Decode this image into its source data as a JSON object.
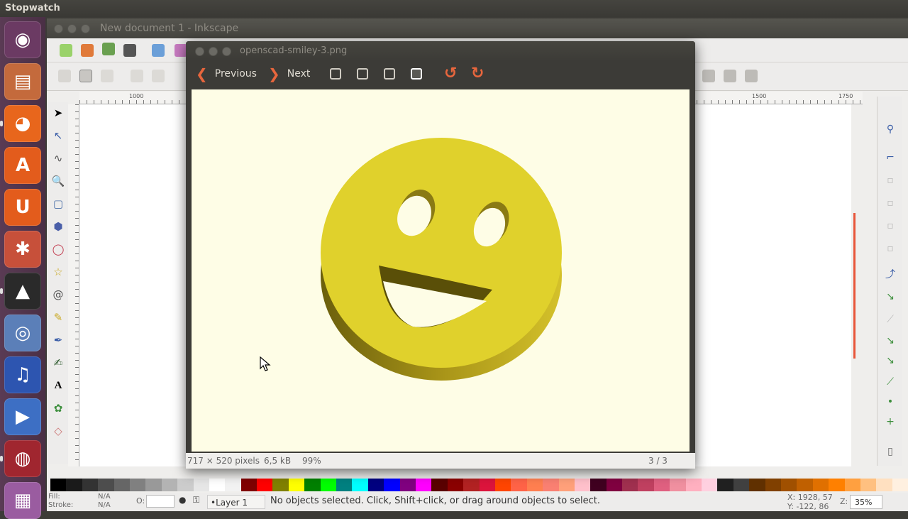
{
  "top_panel": {
    "title": "Stopwatch"
  },
  "launcher": {
    "items": [
      {
        "name": "ubuntu-dash-icon",
        "glyph": "◉",
        "color": "#6b3a63"
      },
      {
        "name": "files-icon",
        "glyph": "▤",
        "color": "#c46a3c"
      },
      {
        "name": "firefox-icon",
        "glyph": "◕",
        "color": "#e8661c"
      },
      {
        "name": "software-center-icon",
        "glyph": "A",
        "color": "#e35c1c"
      },
      {
        "name": "ubuntu-one-icon",
        "glyph": "U",
        "color": "#e35c1c"
      },
      {
        "name": "system-settings-icon",
        "glyph": "✱",
        "color": "#c7503a"
      },
      {
        "name": "inkscape-icon",
        "glyph": "▲",
        "color": "#2a2a2a"
      },
      {
        "name": "chromium-icon",
        "glyph": "◎",
        "color": "#5b7fb8"
      },
      {
        "name": "audacity-icon",
        "glyph": "♫",
        "color": "#2d55b0"
      },
      {
        "name": "media-player-icon",
        "glyph": "▶",
        "color": "#3d6fc4"
      },
      {
        "name": "screen-recorder-icon",
        "glyph": "◍",
        "color": "#a0262f"
      },
      {
        "name": "workspace-switcher-icon",
        "glyph": "▦",
        "color": "#9a5ca0"
      }
    ]
  },
  "inkscape": {
    "title": "New document 1 - Inkscape",
    "ruler_labels": [
      "1000",
      "1500",
      "1750"
    ],
    "status": {
      "fill_label": "Fill:",
      "fill_value": "N/A",
      "stroke_label": "Stroke:",
      "stroke_value": "N/A",
      "opacity_label": "O:",
      "layer": "•Layer 1",
      "message": "No objects selected. Click, Shift+click, or drag around objects to select.",
      "x_coord": "X: 1928, 57",
      "y_coord": "Y: -122, 86",
      "zoom_label": "Z:",
      "zoom_value": "35%"
    }
  },
  "viewer": {
    "title": "openscad-smiley-3.png",
    "prev_label": "Previous",
    "next_label": "Next",
    "dimensions": "717 × 520 pixels",
    "filesize": "6,5 kB",
    "zoom": "99%",
    "position": "3 / 3"
  },
  "colors": {
    "smiley_face": "#e0d12c",
    "smiley_side": "#8a7a14",
    "viewer_bg": "#fefde6",
    "accent": "#e8663d"
  }
}
